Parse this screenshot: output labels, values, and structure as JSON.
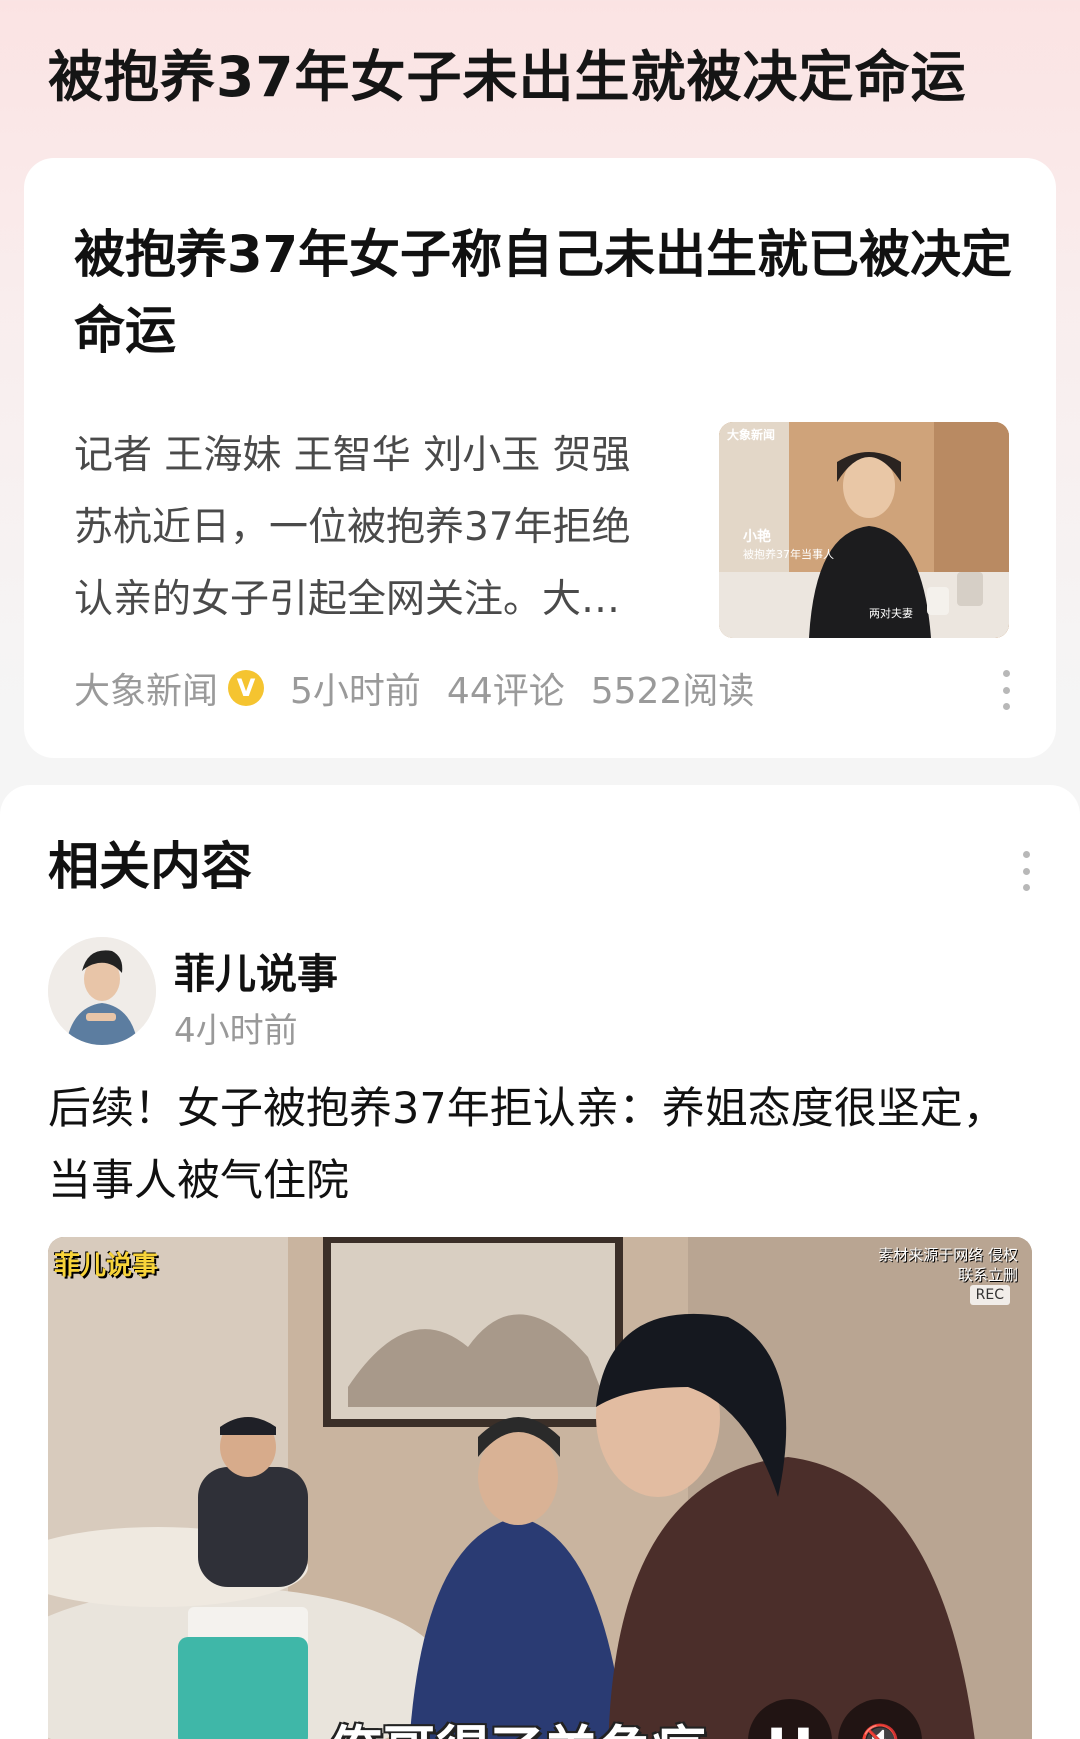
{
  "page": {
    "title": "被抱养37年女子未出生就被决定命运"
  },
  "article": {
    "title": "被抱养37年女子称自己未出生就已被决定命运",
    "summary_lines": [
      "记者 王海妹 王智华 刘小玉 贺强",
      "苏杭近日，一位被抱养37年拒绝",
      "认亲的女子引起全网关注。大…"
    ],
    "source": "大象新闻",
    "verified_mark": "V",
    "time": "5小时前",
    "comments": "44评论",
    "reads": "5522阅读",
    "thumb": {
      "logo": "大象新闻",
      "name_caption": "小艳",
      "role_caption": "被抱养37年当事人",
      "corner_caption": "两对夫妻"
    }
  },
  "related": {
    "heading": "相关内容",
    "post": {
      "author": "菲儿说事",
      "time": "4小时前",
      "title": "后续！女子被抱养37年拒认亲：养姐态度很坚定，当事人被气住院",
      "video": {
        "channel_tag": "菲儿说事",
        "watermark": "素材来源于网络 侵权联系立删",
        "rec_label": "REC",
        "subtitle": "俺哥得了羊角疯"
      }
    }
  },
  "colors": {
    "accent_badge": "#f5c430",
    "text_muted": "#9a9a9a"
  },
  "icons": [
    "verified-icon",
    "more-vertical-icon",
    "pause-icon",
    "mute-icon"
  ]
}
